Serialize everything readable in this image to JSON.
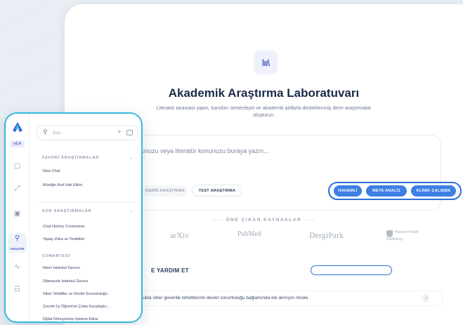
{
  "main": {
    "logo_glyph": "lıı\\",
    "title": "Akademik Araştırma Laboratuvarı",
    "subtitle": "Literatür taraması yapın, kanıtları sentezleyin ve akademik atıflarla desteklenmiş derin araştırmalar oluşturun.",
    "query_placeholder": "unuzu veya literatür konunuzu buraya yazın...",
    "modes": {
      "deep": "DERİN ARAŞTIRMA",
      "test": "TEST ARAŞTIRMA",
      "quick": "HAKEMLİ",
      "meta": "META ANALİZ",
      "clinical": "KLİNİK ÇALIŞMA"
    },
    "send_icon": "arrow-right-icon",
    "sources_title": "ÖNE ÇIKAN KAYNAKLAR",
    "sources": {
      "arxiv": "arXiv",
      "pubmed": "PubMed",
      "dergipark": "DergiPark",
      "harvard": "Harvard Health Publishing"
    },
    "help_title": "E YARDIM ET",
    "help_prompt": "kukta siber güvenlik tehditlerinin devlet sorumluluğu bağlamında ele alınışını incele."
  },
  "sidebar": {
    "version": "v2.4",
    "active_label": "ARAŞTIR",
    "search_placeholder": "Ara...",
    "favorites_title": "FAVORİ ARAŞTIRMALAR",
    "favorites": [
      "New Chat",
      "Müziğin Ruh Hali Etkisi"
    ],
    "recent_title": "SON ARAŞTIRMALAR",
    "recent": [
      "Chat History Conversion",
      "Yapay Zeka ve Yenilikler"
    ],
    "day_title": "CUMARTESİ",
    "day_items": [
      "Neon İstanbul Gecesi",
      "Siberpunk İstanbul Gecesi",
      "Siber Tehditler ve Devlet Sorumluluğu",
      "Çevrim İçi Öğrenme Çoklu Karşılaştır...",
      "Dijital Dönüşümün İşletme Etkisi"
    ]
  },
  "colors": {
    "accent": "#3f7fe3",
    "highlight": "#2c6fd9",
    "sidebar_border": "#35b8dd"
  }
}
